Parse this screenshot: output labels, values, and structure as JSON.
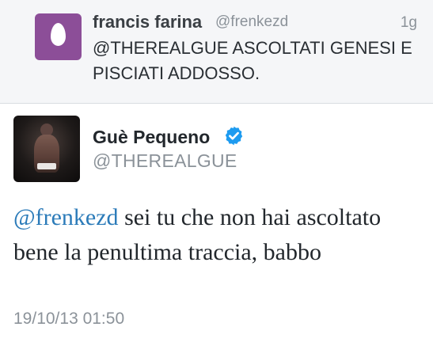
{
  "reply": {
    "name": "francis farina",
    "handle": "@frenkezd",
    "time": "1g",
    "text": "@THEREALGUE ASCOLTATI GENESI E PISCIATI ADDOSSO.",
    "avatar_color": "#8c4e98"
  },
  "tweet": {
    "name": "Guè Pequeno",
    "handle": "@THEREALGUE",
    "mention": "@frenkezd",
    "text": " sei tu che non hai ascoltato bene la penultima traccia, babbo",
    "timestamp": "19/10/13 01:50",
    "verified_icon": "verified-badge-icon",
    "link_color": "#2b7bb9",
    "verified_color": "#1d9bf0"
  }
}
